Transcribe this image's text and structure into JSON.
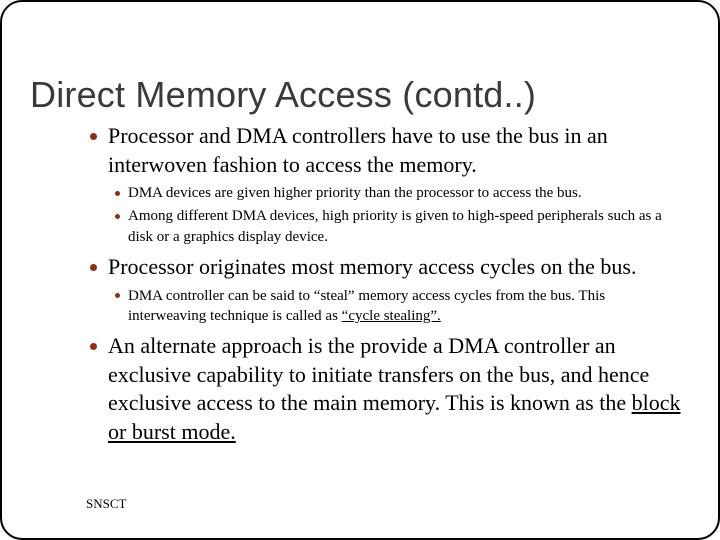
{
  "title": "Direct Memory Access (contd..)",
  "bullets": {
    "b1": "Processor and DMA controllers have to use the bus in an interwoven fashion to access the memory.",
    "b1a": "DMA devices are given higher priority than the processor to access the bus.",
    "b1b": "Among different DMA devices, high priority is given to high-speed peripherals such as a disk or a graphics display device.",
    "b2": "Processor originates most memory access cycles on the bus.",
    "b2a_pre": "DMA controller can be said to “steal” memory access cycles from the bus. This interweaving technique is called as ",
    "b2a_u": "“cycle stealing”.",
    "b3_pre": "An alternate approach is the provide a DMA controller an exclusive capability to initiate transfers on the bus, and hence exclusive access to the main memory. This is known as the ",
    "b3_u": "block or burst mode."
  },
  "footer": "SNSCT"
}
